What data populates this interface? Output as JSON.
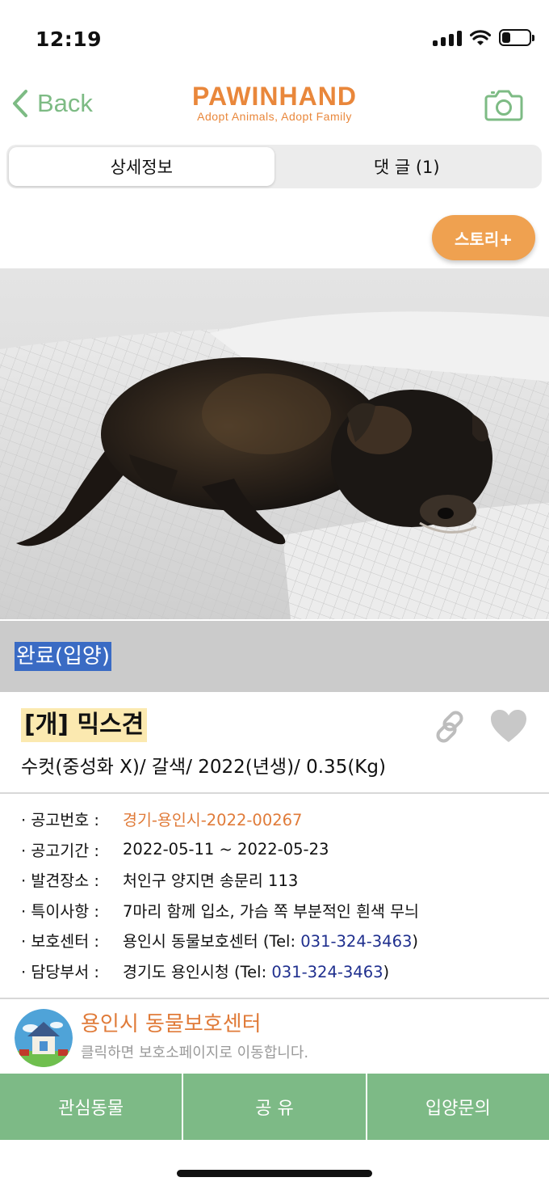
{
  "status_bar": {
    "time": "12:19",
    "battery_level": 0.3
  },
  "nav": {
    "back_label": "Back",
    "logo_title": "PAWINHAND",
    "logo_subtitle": "Adopt Animals, Adopt Family",
    "camera_icon": "camera-icon",
    "accent_color": "#7dbb84",
    "brand_color": "#e9873b"
  },
  "tabs": [
    {
      "label": "상세정보",
      "active": true
    },
    {
      "label": "댓 글 (1)",
      "active": false
    }
  ],
  "story_button": "스토리+",
  "adoption_status": "완료(입양)",
  "animal": {
    "title": "[개] 믹스견",
    "summary": "수컷(중성화 X)/ 갈색/ 2022(년생)/ 0.35(Kg)"
  },
  "details": {
    "notice_no": {
      "key": "· 공고번호 :",
      "value": "경기-용인시-2022-00267"
    },
    "notice_period": {
      "key": "· 공고기간 :",
      "value": "2022-05-11 ~ 2022-05-23"
    },
    "found_place": {
      "key": "· 발견장소 :",
      "value": "처인구 양지면 송문리 113"
    },
    "notes": {
      "key": "· 특이사항 :",
      "value": "7마리 함께 입소, 가슴 쪽 부분적인 흰색 무늬"
    },
    "shelter": {
      "key": "· 보호센터 :",
      "prefix": "용인시 동물보호센터 (Tel: ",
      "tel": "031-324-3463",
      "suffix": ")"
    },
    "department": {
      "key": "· 담당부서 :",
      "prefix": "경기도 용인시청 (Tel: ",
      "tel": "031-324-3463",
      "suffix": ")"
    }
  },
  "shelter_card": {
    "name": "용인시 동물보호센터",
    "hint": "클릭하면 보호소페이지로 이동합니다."
  },
  "actions": {
    "interest": "관심동물",
    "share": "공 유",
    "inquiry": "입양문의"
  }
}
